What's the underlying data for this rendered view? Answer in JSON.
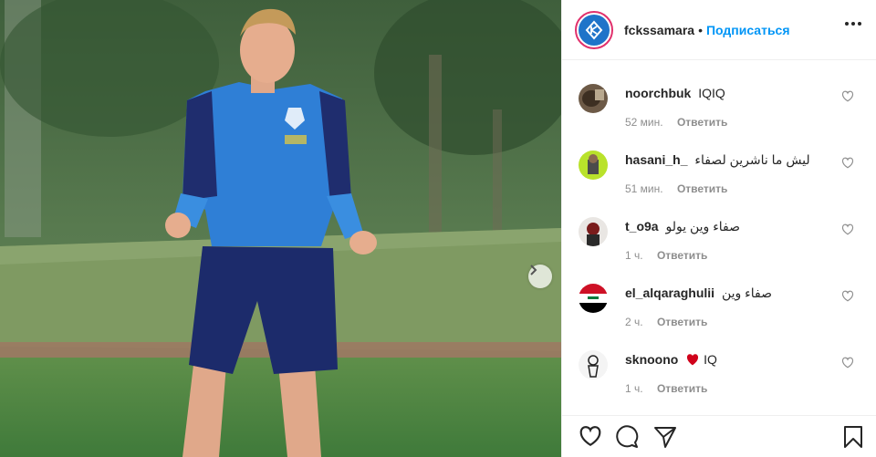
{
  "post": {
    "username": "fckssamara",
    "separator": "•",
    "follow_label": "Подписаться"
  },
  "comments": [
    {
      "username": "noorchbuk",
      "text": "IQIQ",
      "time": "52 мин.",
      "reply": "Ответить"
    },
    {
      "username": "hasani_h_",
      "text": "ليش ما ناشرين لصفاء",
      "time": "51 мин.",
      "reply": "Ответить"
    },
    {
      "username": "t_o9a",
      "text": "صفاء وين يولو",
      "time": "1 ч.",
      "reply": "Ответить"
    },
    {
      "username": "el_alqaraghulii",
      "text": "صفاء وين",
      "time": "2 ч.",
      "reply": "Ответить"
    },
    {
      "username": "sknoono",
      "text": "IQ",
      "time": "1 ч.",
      "reply": "Ответить"
    }
  ],
  "colors": {
    "follow": "#0095f6",
    "accent_ring": "#e1306c",
    "heart_emoji": "#d0021b"
  },
  "icons": [
    "chevron-right-icon",
    "more-icon",
    "heart-icon",
    "comment-icon",
    "share-icon",
    "bookmark-icon"
  ]
}
